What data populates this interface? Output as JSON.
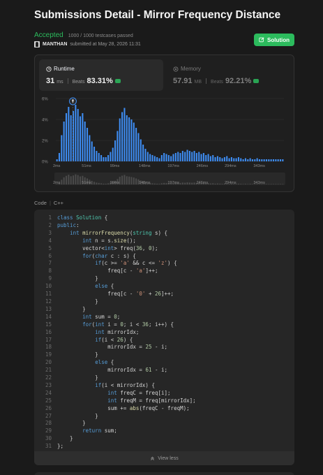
{
  "page": {
    "title": "Submissions Detail - Mirror Frequency Distance"
  },
  "submission": {
    "status": "Accepted",
    "passed": "1000 / 1000 testcases passed",
    "author": "MANTHAN",
    "submitted": "submitted at May 28, 2026 11:31"
  },
  "solution_button": {
    "label": "Solution"
  },
  "runtime": {
    "label": "Runtime",
    "value": "31",
    "unit": "ms",
    "beats_label": "Beats",
    "beats": "83.31%"
  },
  "memory": {
    "label": "Memory",
    "value": "57.91",
    "unit": "MB",
    "beats_label": "Beats",
    "beats": "92.21%"
  },
  "chart_data": {
    "type": "bar",
    "title": "",
    "xlabel": "",
    "ylabel": "",
    "y_ticks": [
      "6%",
      "4%",
      "2%",
      "0%"
    ],
    "ylim": [
      0,
      6
    ],
    "x_ticks": [
      "2ms",
      "51ms",
      "99ms",
      "148ms",
      "197ms",
      "246ms",
      "294ms",
      "343ms"
    ],
    "xlim": [
      2,
      390
    ],
    "highlight_x": 31,
    "bar_color": "#3e8df3",
    "values": [
      0.2,
      0.8,
      2.5,
      3.8,
      4.6,
      5.2,
      4.4,
      4.8,
      5.4,
      5.0,
      4.3,
      4.6,
      3.8,
      3.2,
      2.5,
      1.9,
      1.4,
      1.0,
      0.8,
      0.6,
      0.4,
      0.4,
      0.6,
      0.9,
      1.3,
      2.0,
      2.9,
      4.1,
      4.7,
      5.1,
      4.4,
      4.2,
      4.0,
      3.7,
      3.2,
      2.7,
      2.1,
      1.6,
      1.2,
      0.9,
      0.7,
      0.6,
      0.5,
      0.4,
      0.3,
      0.6,
      0.8,
      0.7,
      0.6,
      0.5,
      0.7,
      0.8,
      0.9,
      0.8,
      1.0,
      0.9,
      1.1,
      1.0,
      0.9,
      1.0,
      0.8,
      0.9,
      0.7,
      0.8,
      0.6,
      0.7,
      0.5,
      0.6,
      0.4,
      0.5,
      0.4,
      0.3,
      0.4,
      0.5,
      0.3,
      0.4,
      0.3,
      0.3,
      0.4,
      0.3,
      0.2,
      0.3,
      0.2,
      0.3,
      0.2,
      0.2,
      0.3,
      0.2,
      0.2,
      0.2,
      0.2,
      0.2,
      0.2,
      0.2,
      0.2,
      0.2,
      0.2,
      0.2
    ]
  },
  "code": {
    "language_label": "Code",
    "language": "C++",
    "view_less": "View less",
    "lines": [
      [
        [
          "kw",
          "class"
        ],
        [
          "tx",
          " "
        ],
        [
          "tp",
          "Solution"
        ],
        [
          "tx",
          " {"
        ]
      ],
      [
        [
          "kw",
          "public"
        ],
        [
          "tx",
          ":"
        ]
      ],
      [
        [
          "tx",
          "    "
        ],
        [
          "kw",
          "int"
        ],
        [
          "tx",
          " "
        ],
        [
          "fn",
          "mirrorFrequency"
        ],
        [
          "tx",
          "("
        ],
        [
          "tp",
          "string"
        ],
        [
          "tx",
          " s) {"
        ]
      ],
      [
        [
          "tx",
          "        "
        ],
        [
          "kw",
          "int"
        ],
        [
          "tx",
          " n = s."
        ],
        [
          "fn",
          "size"
        ],
        [
          "tx",
          "();"
        ]
      ],
      [
        [
          "tx",
          "        vector<"
        ],
        [
          "kw",
          "int"
        ],
        [
          "tx",
          "> freq("
        ],
        [
          "nm",
          "36"
        ],
        [
          "tx",
          ", "
        ],
        [
          "nm",
          "0"
        ],
        [
          "tx",
          ");"
        ]
      ],
      [
        [
          "tx",
          "        "
        ],
        [
          "kw",
          "for"
        ],
        [
          "tx",
          "("
        ],
        [
          "kw",
          "char"
        ],
        [
          "tx",
          " c : s) {"
        ]
      ],
      [
        [
          "tx",
          "            "
        ],
        [
          "kw",
          "if"
        ],
        [
          "tx",
          "(c >= "
        ],
        [
          "st",
          "'a'"
        ],
        [
          "tx",
          " && c <= "
        ],
        [
          "st",
          "'z'"
        ],
        [
          "tx",
          ") {"
        ]
      ],
      [
        [
          "tx",
          "                freq[c - "
        ],
        [
          "st",
          "'a'"
        ],
        [
          "tx",
          "]++;"
        ]
      ],
      [
        [
          "tx",
          "            }"
        ]
      ],
      [
        [
          "tx",
          "            "
        ],
        [
          "kw",
          "else"
        ],
        [
          "tx",
          " {"
        ]
      ],
      [
        [
          "tx",
          "                freq[c - "
        ],
        [
          "st",
          "'0'"
        ],
        [
          "tx",
          " + "
        ],
        [
          "nm",
          "26"
        ],
        [
          "tx",
          "]++;"
        ]
      ],
      [
        [
          "tx",
          "            }"
        ]
      ],
      [
        [
          "tx",
          "        }"
        ]
      ],
      [
        [
          "tx",
          "        "
        ],
        [
          "kw",
          "int"
        ],
        [
          "tx",
          " sum = "
        ],
        [
          "nm",
          "0"
        ],
        [
          "tx",
          ";"
        ]
      ],
      [
        [
          "tx",
          "        "
        ],
        [
          "kw",
          "for"
        ],
        [
          "tx",
          "("
        ],
        [
          "kw",
          "int"
        ],
        [
          "tx",
          " i = "
        ],
        [
          "nm",
          "0"
        ],
        [
          "tx",
          "; i < "
        ],
        [
          "nm",
          "36"
        ],
        [
          "tx",
          "; i++) {"
        ]
      ],
      [
        [
          "tx",
          "            "
        ],
        [
          "kw",
          "int"
        ],
        [
          "tx",
          " mirrorIdx;"
        ]
      ],
      [
        [
          "tx",
          "            "
        ],
        [
          "kw",
          "if"
        ],
        [
          "tx",
          "(i < "
        ],
        [
          "nm",
          "26"
        ],
        [
          "tx",
          ") {"
        ]
      ],
      [
        [
          "tx",
          "                mirrorIdx = "
        ],
        [
          "nm",
          "25"
        ],
        [
          "tx",
          " - i;"
        ]
      ],
      [
        [
          "tx",
          "            }"
        ]
      ],
      [
        [
          "tx",
          "            "
        ],
        [
          "kw",
          "else"
        ],
        [
          "tx",
          " {"
        ]
      ],
      [
        [
          "tx",
          "                mirrorIdx = "
        ],
        [
          "nm",
          "61"
        ],
        [
          "tx",
          " - i;"
        ]
      ],
      [
        [
          "tx",
          "            }"
        ]
      ],
      [
        [
          "tx",
          "            "
        ],
        [
          "kw",
          "if"
        ],
        [
          "tx",
          "(i < mirrorIdx) {"
        ]
      ],
      [
        [
          "tx",
          "                "
        ],
        [
          "kw",
          "int"
        ],
        [
          "tx",
          " freqC = freq[i];"
        ]
      ],
      [
        [
          "tx",
          "                "
        ],
        [
          "kw",
          "int"
        ],
        [
          "tx",
          " freqM = freq[mirrorIdx];"
        ]
      ],
      [
        [
          "tx",
          "                sum += "
        ],
        [
          "fn",
          "abs"
        ],
        [
          "tx",
          "(freqC - freqM);"
        ]
      ],
      [
        [
          "tx",
          "            }"
        ]
      ],
      [
        [
          "tx",
          "        }"
        ]
      ],
      [
        [
          "tx",
          "        "
        ],
        [
          "kw",
          "return"
        ],
        [
          "tx",
          " sum;"
        ]
      ],
      [
        [
          "tx",
          "    }"
        ]
      ],
      [
        [
          "tx",
          "};"
        ]
      ]
    ]
  }
}
